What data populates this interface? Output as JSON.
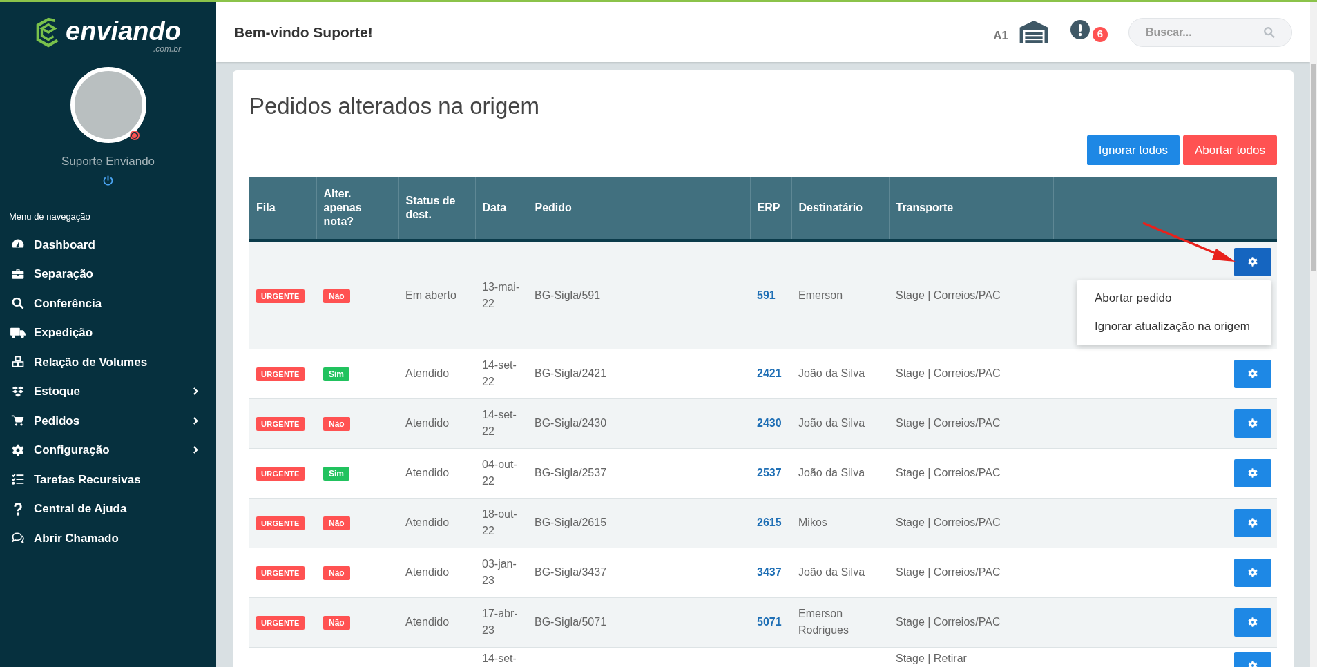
{
  "sidebar": {
    "logo": {
      "name": "enviando",
      "domain": ".com.br"
    },
    "user": {
      "name": "Suporte Enviando"
    },
    "menu_title": "Menu de navegação",
    "items": [
      {
        "label": "Dashboard",
        "has_submenu": false
      },
      {
        "label": "Separação",
        "has_submenu": false
      },
      {
        "label": "Conferência",
        "has_submenu": false
      },
      {
        "label": "Expedição",
        "has_submenu": false
      },
      {
        "label": "Relação de Volumes",
        "has_submenu": false
      },
      {
        "label": "Estoque",
        "has_submenu": true
      },
      {
        "label": "Pedidos",
        "has_submenu": true
      },
      {
        "label": "Configuração",
        "has_submenu": true
      },
      {
        "label": "Tarefas Recursivas",
        "has_submenu": false
      },
      {
        "label": "Central de Ajuda",
        "has_submenu": false
      },
      {
        "label": "Abrir Chamado",
        "has_submenu": false
      }
    ]
  },
  "header": {
    "greeting": "Bem-vindo Suporte!",
    "warehouse_code": "A1",
    "alert_count": "6",
    "search": {
      "placeholder": "Buscar..."
    }
  },
  "page": {
    "title": "Pedidos alterados na origem",
    "actions": [
      {
        "label": "Ignorar todos",
        "kind": "primary"
      },
      {
        "label": "Abortar todos",
        "kind": "danger"
      }
    ]
  },
  "table": {
    "columns": [
      "Fila",
      "Alter. apenas nota?",
      "Status de dest.",
      "Data",
      "Pedido",
      "ERP",
      "Destinatário",
      "Transporte"
    ],
    "rows": [
      {
        "fila": "URGENTE",
        "alter": {
          "label": "Não",
          "color": "#ff5252"
        },
        "status": "Em aberto",
        "date": "13-mai-22",
        "pedido": "BG-Sigla/591",
        "erp": "591",
        "destinatario": "Emerson",
        "transporte": "Stage | Correios/PAC",
        "menu_open": true,
        "menu": [
          "Abortar pedido",
          "Ignorar atualização na origem"
        ]
      },
      {
        "fila": "URGENTE",
        "alter": {
          "label": "Sim",
          "color": "#21c25e"
        },
        "status": "Atendido",
        "date": "14-set-22",
        "pedido": "BG-Sigla/2421",
        "erp": "2421",
        "destinatario": "João da Silva",
        "transporte": "Stage | Correios/PAC",
        "menu_open": false
      },
      {
        "fila": "URGENTE",
        "alter": {
          "label": "Não",
          "color": "#ff5252"
        },
        "status": "Atendido",
        "date": "14-set-22",
        "pedido": "BG-Sigla/2430",
        "erp": "2430",
        "destinatario": "João da Silva",
        "transporte": "Stage | Correios/PAC",
        "menu_open": false
      },
      {
        "fila": "URGENTE",
        "alter": {
          "label": "Sim",
          "color": "#21c25e"
        },
        "status": "Atendido",
        "date": "04-out-22",
        "pedido": "BG-Sigla/2537",
        "erp": "2537",
        "destinatario": "João da Silva",
        "transporte": "Stage | Correios/PAC",
        "menu_open": false
      },
      {
        "fila": "URGENTE",
        "alter": {
          "label": "Não",
          "color": "#ff5252"
        },
        "status": "Atendido",
        "date": "18-out-22",
        "pedido": "BG-Sigla/2615",
        "erp": "2615",
        "destinatario": "Mikos",
        "transporte": "Stage | Correios/PAC",
        "menu_open": false
      },
      {
        "fila": "URGENTE",
        "alter": {
          "label": "Não",
          "color": "#ff5252"
        },
        "status": "Atendido",
        "date": "03-jan-23",
        "pedido": "BG-Sigla/3437",
        "erp": "3437",
        "destinatario": "João da Silva",
        "transporte": "Stage | Correios/PAC",
        "menu_open": false
      },
      {
        "fila": "URGENTE",
        "alter": {
          "label": "Não",
          "color": "#ff5252"
        },
        "status": "Atendido",
        "date": "17-abr-23",
        "pedido": "BG-Sigla/5071",
        "erp": "5071",
        "destinatario": "Emerson Rodrigues",
        "transporte": "Stage | Correios/PAC",
        "menu_open": false
      },
      {
        "date": "14-set-",
        "transporte": "Stage | Retirar",
        "menu_open": false
      }
    ]
  }
}
